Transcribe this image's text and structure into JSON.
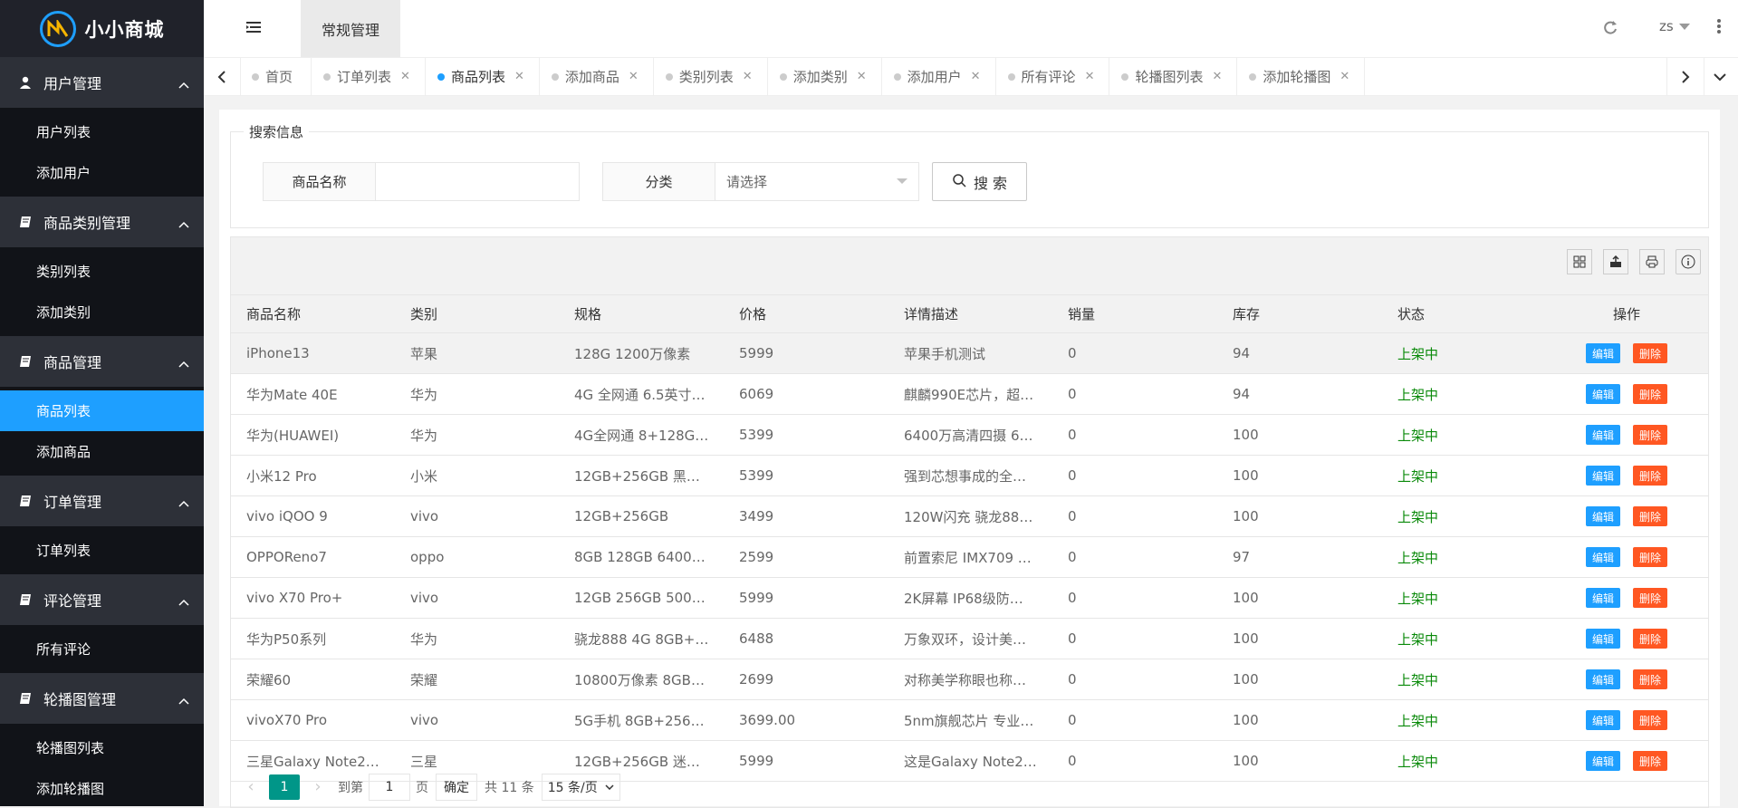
{
  "app": {
    "brand": "小小商城"
  },
  "sidebar": {
    "groups": [
      {
        "title": "用户管理",
        "items": [
          {
            "label": "用户列表",
            "active": false
          },
          {
            "label": "添加用户",
            "active": false
          }
        ]
      },
      {
        "title": "商品类别管理",
        "items": [
          {
            "label": "类别列表",
            "active": false
          },
          {
            "label": "添加类别",
            "active": false
          }
        ]
      },
      {
        "title": "商品管理",
        "items": [
          {
            "label": "商品列表",
            "active": true
          },
          {
            "label": "添加商品",
            "active": false
          }
        ]
      },
      {
        "title": "订单管理",
        "items": [
          {
            "label": "订单列表",
            "active": false
          }
        ]
      },
      {
        "title": "评论管理",
        "items": [
          {
            "label": "所有评论",
            "active": false
          }
        ]
      },
      {
        "title": "轮播图管理",
        "items": [
          {
            "label": "轮播图列表",
            "active": false
          },
          {
            "label": "添加轮播图",
            "active": false
          }
        ]
      }
    ]
  },
  "header": {
    "tab": "常规管理",
    "user": "zs"
  },
  "tabs": [
    {
      "label": "首页",
      "active": false,
      "closable": false
    },
    {
      "label": "订单列表",
      "active": false,
      "closable": true
    },
    {
      "label": "商品列表",
      "active": true,
      "closable": true
    },
    {
      "label": "添加商品",
      "active": false,
      "closable": true
    },
    {
      "label": "类别列表",
      "active": false,
      "closable": true
    },
    {
      "label": "添加类别",
      "active": false,
      "closable": true
    },
    {
      "label": "添加用户",
      "active": false,
      "closable": true
    },
    {
      "label": "所有评论",
      "active": false,
      "closable": true
    },
    {
      "label": "轮播图列表",
      "active": false,
      "closable": true
    },
    {
      "label": "添加轮播图",
      "active": false,
      "closable": true
    }
  ],
  "search": {
    "legend": "搜索信息",
    "name_label": "商品名称",
    "name_value": "",
    "category_label": "分类",
    "category_value": "请选择",
    "button": "搜 索"
  },
  "table": {
    "columns": [
      "商品名称",
      "类别",
      "规格",
      "价格",
      "详情描述",
      "销量",
      "库存",
      "状态",
      "操作"
    ],
    "edit_label": "编辑",
    "delete_label": "删除",
    "rows": [
      {
        "name": "iPhone13",
        "category": "苹果",
        "spec": "128G 1200万像素",
        "price": "5999",
        "desc": "苹果手机测试",
        "sales": "0",
        "stock": "94",
        "status": "上架中"
      },
      {
        "name": "华为Mate 40E",
        "category": "华为",
        "spec": "4G 全网通 6.5英寸…",
        "price": "6069",
        "desc": "麒麟990E芯片，超…",
        "sales": "0",
        "stock": "94",
        "status": "上架中"
      },
      {
        "name": "华为(HUAWEI)",
        "category": "华为",
        "spec": "4G全网通 8+128G…",
        "price": "5399",
        "desc": "6400万高清四摄 6…",
        "sales": "0",
        "stock": "100",
        "status": "上架中"
      },
      {
        "name": "小米12 Pro",
        "category": "小米",
        "spec": "12GB+256GB 黑…",
        "price": "5399",
        "desc": "强到芯想事成的全…",
        "sales": "0",
        "stock": "100",
        "status": "上架中"
      },
      {
        "name": "vivo iQOO 9",
        "category": "vivo",
        "spec": "12GB+256GB",
        "price": "3499",
        "desc": "120W闪充 骁龙88…",
        "sales": "0",
        "stock": "100",
        "status": "上架中"
      },
      {
        "name": "OPPOReno7",
        "category": "oppo",
        "spec": "8GB 128GB 6400…",
        "price": "2599",
        "desc": "前置索尼 IMX709 …",
        "sales": "0",
        "stock": "97",
        "status": "上架中"
      },
      {
        "name": "vivo X70 Pro+",
        "category": "vivo",
        "spec": "12GB 256GB 500…",
        "price": "5999",
        "desc": "2K屏幕 IP68级防…",
        "sales": "0",
        "stock": "100",
        "status": "上架中"
      },
      {
        "name": "华为P50系列",
        "category": "华为",
        "spec": "骁龙888 4G 8GB+…",
        "price": "6488",
        "desc": "万象双环，设计美…",
        "sales": "0",
        "stock": "100",
        "status": "上架中"
      },
      {
        "name": "荣耀60",
        "category": "荣耀",
        "spec": "10800万像素 8GB…",
        "price": "2699",
        "desc": "对称美学称眼也称…",
        "sales": "0",
        "stock": "100",
        "status": "上架中"
      },
      {
        "name": "vivoX70 Pro",
        "category": "vivo",
        "spec": "5G手机 8GB+256…",
        "price": "3699.00",
        "desc": "5nm旗舰芯片 专业…",
        "sales": "0",
        "stock": "100",
        "status": "上架中"
      },
      {
        "name": "三星Galaxy Note2…",
        "category": "三星",
        "spec": "12GB+256GB 迷…",
        "price": "5999",
        "desc": "这是Galaxy Note2…",
        "sales": "0",
        "stock": "100",
        "status": "上架中"
      }
    ]
  },
  "pager": {
    "current": "1",
    "goto_prefix": "到第",
    "goto_value": "1",
    "goto_suffix": "页",
    "confirm": "确定",
    "total": "共 11 条",
    "page_size": "15 条/页"
  },
  "colors": {
    "accent": "#1e9fff",
    "sidebar": "#20222a",
    "danger": "#ff5722",
    "success": "#0a8a0a",
    "pager": "#009688"
  }
}
